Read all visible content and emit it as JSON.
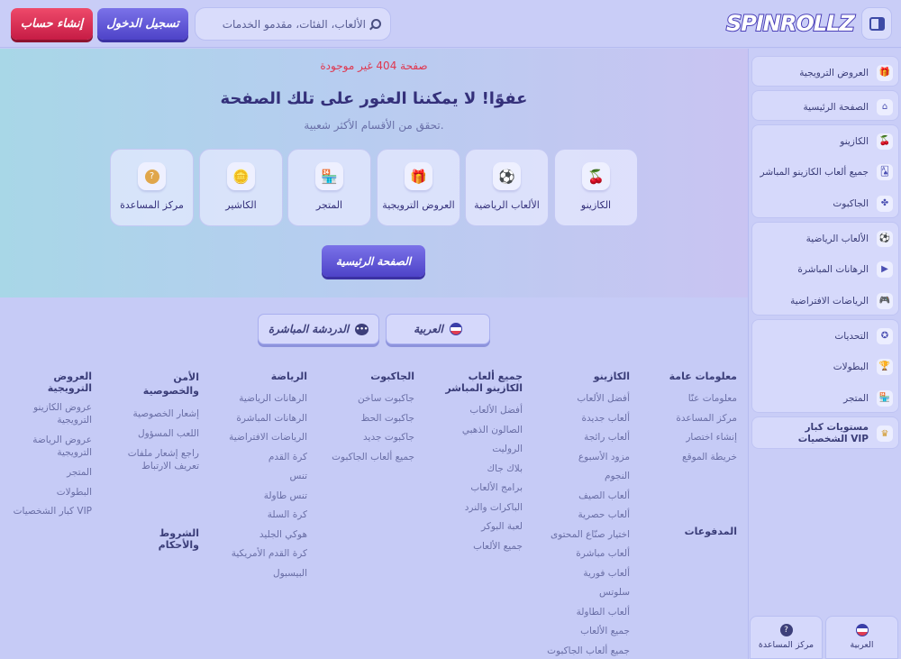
{
  "header": {
    "logo": "SPINROLLZ",
    "search_placeholder": "الألعاب، الفئات، مقدمو الخدمات",
    "login": "تسجيل الدخول",
    "register": "إنشاء حساب"
  },
  "hero": {
    "error": "صفحة 404 غير موجودة",
    "title": "عفوًا! لا يمكننا العثور على تلك الصفحة",
    "subtitle": "تحقق من الأقسام الأكثر شعبية.",
    "home_button": "الصفحة الرئيسية",
    "cards": [
      {
        "label": "الكازينو",
        "icon": "cherry-icon"
      },
      {
        "label": "الألعاب الرياضية",
        "icon": "ball-icon"
      },
      {
        "label": "العروض الترويجية",
        "icon": "gift-icon"
      },
      {
        "label": "المتجر",
        "icon": "shop-icon"
      },
      {
        "label": "الكاشير",
        "icon": "coins-icon"
      },
      {
        "label": "مركز المساعدة",
        "icon": "help-icon"
      }
    ]
  },
  "footer": {
    "language": "العربية",
    "chat": "الدردشة المباشرة",
    "columns": [
      {
        "title": "معلومات عامة",
        "items": [
          "معلومات عنّا",
          "مركز المساعدة",
          "إنشاء اختصار",
          "خريطة الموقع"
        ]
      },
      {
        "title": "الكازينو",
        "items": [
          "أفضل الألعاب",
          "ألعاب جديدة",
          "ألعاب رائجة",
          "مزود الأسبوع",
          "النجوم",
          "ألعاب الصيف",
          "ألعاب حصرية",
          "اختيار صنّاع المحتوى",
          "ألعاب مباشرة",
          "ألعاب فورية",
          "سلوتس",
          "ألعاب الطاولة",
          "جميع الألعاب",
          "جميع ألعاب الجاكبوت"
        ]
      },
      {
        "title": "جميع ألعاب الكازينو المباشر",
        "items": [
          "أفضل الألعاب",
          "الصالون الذهبي",
          "الروليت",
          "بلاك جاك",
          "برامج الألعاب",
          "الباكرات والنرد",
          "لعبة البوكر",
          "جميع الألعاب"
        ]
      },
      {
        "title": "الجاكبوت",
        "items": [
          "جاكبوت ساخن",
          "جاكبوت الحظ",
          "جاكبوت جديد",
          "جميع ألعاب الجاكبوت"
        ]
      },
      {
        "title": "الرياضة",
        "items": [
          "الرهانات الرياضية",
          "الرهانات المباشرة",
          "الرياضات الافتراضية",
          "كرة القدم",
          "تنس",
          "تنس طاولة",
          "كرة السلة",
          "هوكي الجليد",
          "كرة القدم الأمريكية",
          "البيسبول"
        ]
      },
      {
        "title": "الأمن والخصوصية",
        "items": [
          "إشعار الخصوصية",
          "اللعب المسؤول",
          "راجع إشعار ملفات تعريف الارتباط"
        ]
      },
      {
        "title": "العروض الترويجية",
        "items": [
          "عروض الكازينو الترويجية",
          "عروض الرياضة الترويجية",
          "المتجر",
          "البطولات",
          "كبار الشخصيات VIP"
        ]
      }
    ],
    "payments": "المدفوعات",
    "terms": "الشروط والأحكام"
  },
  "sidebar": {
    "items": [
      {
        "label": "العروض الترويجية",
        "icon": "gift-icon"
      },
      {
        "label": "الصفحة الرئيسية",
        "icon": "home-icon"
      },
      {
        "label": "الكازينو",
        "icon": "cherry-icon"
      },
      {
        "label": "جميع ألعاب الكازينو المباشر",
        "icon": "cards-icon"
      },
      {
        "label": "الجاكبوت",
        "icon": "clover-icon"
      },
      {
        "label": "الألعاب الرياضية",
        "icon": "ball-icon"
      },
      {
        "label": "الرهانات المباشرة",
        "icon": "play-icon"
      },
      {
        "label": "الرياضات الافتراضية",
        "icon": "gamepad-icon"
      },
      {
        "label": "التحديات",
        "icon": "badge-icon"
      },
      {
        "label": "البطولات",
        "icon": "trophy-icon"
      },
      {
        "label": "المتجر",
        "icon": "shop-icon"
      },
      {
        "label": "مستويات كبار الشخصيات VIP",
        "icon": "crown-icon"
      }
    ]
  },
  "bottom_tabs": [
    {
      "label": "العربية"
    },
    {
      "label": "مركز المساعدة"
    }
  ]
}
